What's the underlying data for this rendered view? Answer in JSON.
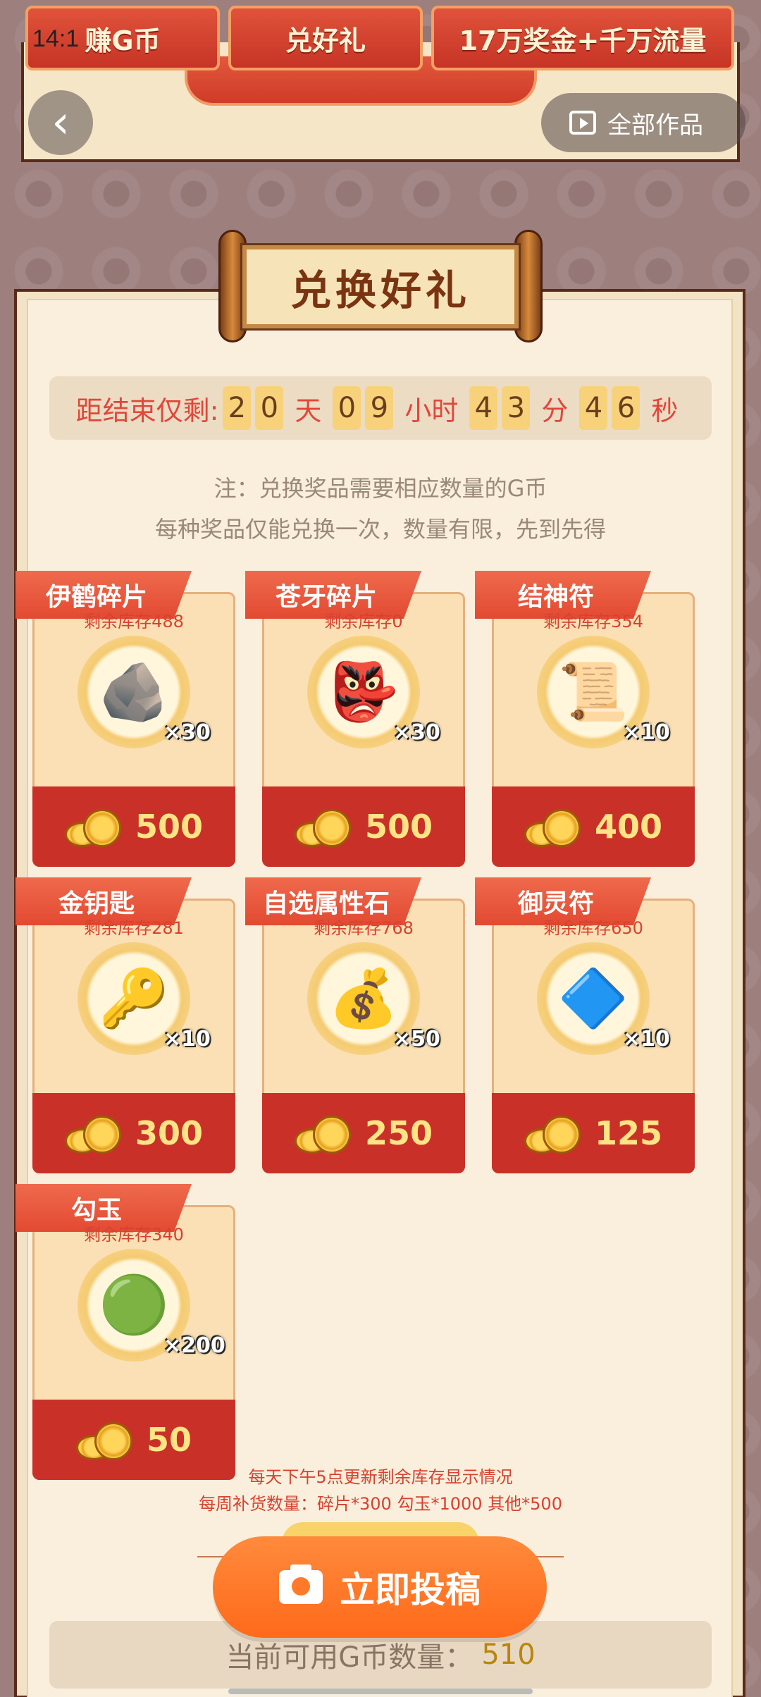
{
  "status_bar": {
    "time": "14:1"
  },
  "top_tabs": [
    {
      "label": "赚G币"
    },
    {
      "label": "兑好礼"
    },
    {
      "label": "17万奖金+千万流量"
    }
  ],
  "nav": {
    "all_works_label": "全部作品"
  },
  "title": "兑换好礼",
  "countdown": {
    "prefix": "距结束仅剩:",
    "days": [
      "2",
      "0"
    ],
    "days_label": "天",
    "hours": [
      "0",
      "9"
    ],
    "hours_label": "小时",
    "minutes": [
      "4",
      "3"
    ],
    "minutes_label": "分",
    "seconds": [
      "4",
      "6"
    ],
    "seconds_label": "秒"
  },
  "notes": {
    "line1": "注：兑换奖品需要相应数量的G币",
    "line2": "每种奖品仅能兑换一次，数量有限，先到先得"
  },
  "prizes": [
    {
      "name": "伊鹤碎片",
      "stock": "剩余库存488",
      "qty": "×30",
      "price": "500",
      "icon": "🪨"
    },
    {
      "name": "苍牙碎片",
      "stock": "剩余库存0",
      "qty": "×30",
      "price": "500",
      "icon": "👺"
    },
    {
      "name": "结神符",
      "stock": "剩余库存354",
      "qty": "×10",
      "price": "400",
      "icon": "📜"
    },
    {
      "name": "金钥匙",
      "stock": "剩余库存281",
      "qty": "×10",
      "price": "300",
      "icon": "🔑"
    },
    {
      "name": "自选属性石",
      "stock": "剩余库存768",
      "qty": "×50",
      "price": "250",
      "icon": "💰"
    },
    {
      "name": "御灵符",
      "stock": "剩余库存650",
      "qty": "×10",
      "price": "125",
      "icon": "🔷"
    },
    {
      "name": "勾玉",
      "stock": "剩余库存340",
      "qty": "×200",
      "price": "50",
      "icon": "🟢"
    }
  ],
  "footer": {
    "line1": "每天下午5点更新剩余库存显示情况",
    "line2": "每周补货数量：碎片*300  勾玉*1000 其他*500"
  },
  "submit_label": "立即投稿",
  "balance": {
    "label": "当前可用G币数量：",
    "value": "510"
  }
}
